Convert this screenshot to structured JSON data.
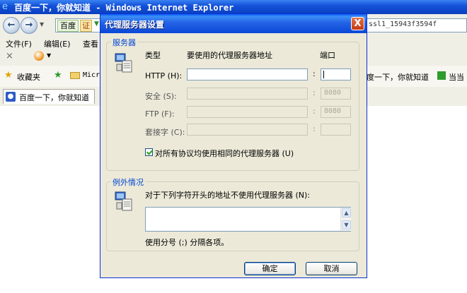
{
  "browser": {
    "title": "百度一下，你就知道 - Windows Internet Explorer",
    "address_badge1": "百度",
    "address_badge2": "证",
    "url": "ssl1_15943f3594f",
    "menu": [
      "文件(F)",
      "编辑(E)",
      "查看"
    ],
    "favorites_label": "收藏夹",
    "fav_link_partial": "Micr",
    "fav_right_text": "度一下，你就知道",
    "fav_right_text2": "当当",
    "tab_label": "百度一下，你就知道",
    "toolbar_close": "×"
  },
  "dialog": {
    "title": "代理服务器设置",
    "close_label": "X",
    "servers": {
      "legend": "服务器",
      "col_type": "类型",
      "col_address": "要使用的代理服务器地址",
      "col_port": "端口",
      "rows": [
        {
          "label": "HTTP (H):",
          "address": "",
          "port": "",
          "enabled": true
        },
        {
          "label": "安全 (S):",
          "address": "",
          "port": "8080",
          "enabled": false
        },
        {
          "label": "FTP (F):",
          "address": "",
          "port": "8080",
          "enabled": false
        },
        {
          "label": "套接字 (C):",
          "address": "",
          "port": "",
          "enabled": false
        }
      ],
      "same_proxy_label": "对所有协议均使用相同的代理服务器 (U)",
      "same_proxy_checked": true
    },
    "exceptions": {
      "legend": "例外情况",
      "description": "对于下列字符开头的地址不使用代理服务器 (N):",
      "value": "",
      "hint": "使用分号 (;) 分隔各项。"
    },
    "ok_label": "确定",
    "cancel_label": "取消"
  },
  "colors": {
    "xp_titlebar": "#0a48d6",
    "dialog_face": "#ece9d8",
    "legend_blue": "#0046d5"
  }
}
